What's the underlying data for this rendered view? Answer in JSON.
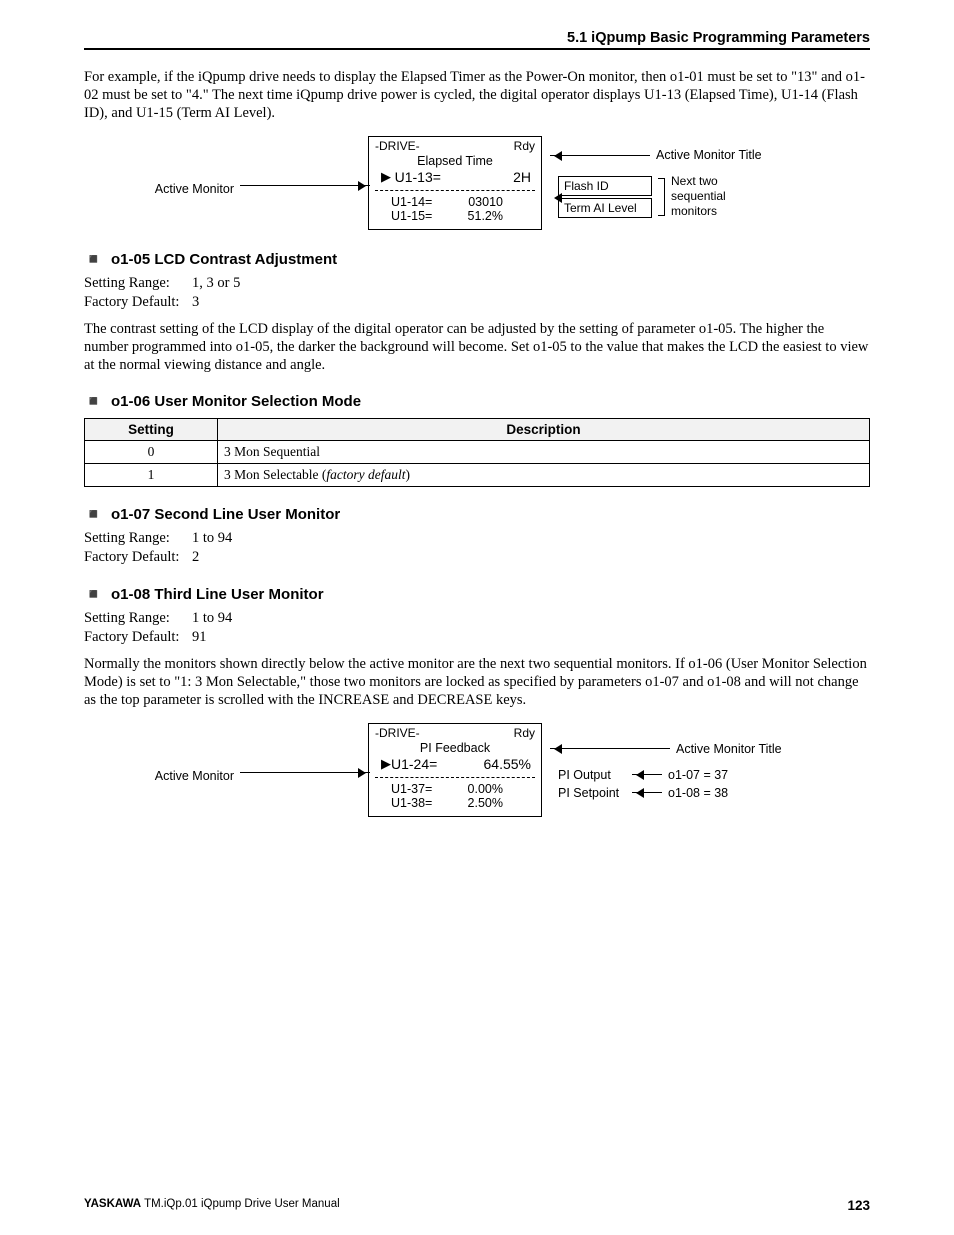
{
  "header": {
    "title": "5.1  iQpump Basic Programming Parameters"
  },
  "intro_para": "For example, if the iQpump drive needs to display the Elapsed Timer as the Power-On monitor, then o1-01 must be set to \"13\" and o1-02 must be set to \"4.\" The next time iQpump drive power is cycled, the digital operator displays U1-13 (Elapsed Time), U1-14 (Flash ID), and U1-15 (Term AI Level).",
  "diagram1": {
    "left_label": "Active Monitor",
    "lcd": {
      "top_left": "-DRIVE-",
      "top_right": "Rdy",
      "title": "Elapsed Time",
      "main_lbl": "U1-13=",
      "main_val": "2H",
      "sub1_lbl": "U1-14=",
      "sub1_val": "03010",
      "sub2_lbl": "U1-15=",
      "sub2_val": "51.2%"
    },
    "right": {
      "title_label": "Active Monitor Title",
      "box_line1": "Flash ID",
      "box_line2": "Term AI Level",
      "stack_label": "Next two\nsequential\nmonitors"
    }
  },
  "s1": {
    "heading": "o1-05 LCD Contrast Adjustment",
    "range_k": "Setting Range:",
    "range_v": "1, 3 or 5",
    "def_k": "Factory Default:",
    "def_v": "3",
    "body": "The contrast setting of the LCD display of the digital operator can be adjusted by the setting of parameter o1-05. The higher the number programmed into o1-05, the darker the background will become. Set o1-05 to the value that makes the LCD the easiest to view at the normal viewing distance and angle."
  },
  "s2": {
    "heading": "o1-06 User Monitor Selection Mode",
    "table": {
      "h1": "Setting",
      "h2": "Description",
      "rows": [
        {
          "setting": "0",
          "desc": "3 Mon Sequential"
        },
        {
          "setting": "1",
          "desc_pre": "3 Mon Selectable (",
          "desc_it": "factory default",
          "desc_post": ")"
        }
      ]
    }
  },
  "s3": {
    "heading": "o1-07 Second Line User Monitor",
    "range_k": "Setting Range:",
    "range_v": "1 to 94",
    "def_k": "Factory Default:",
    "def_v": "2"
  },
  "s4": {
    "heading": "o1-08 Third Line User Monitor",
    "range_k": "Setting Range:",
    "range_v": "1 to 94",
    "def_k": "Factory Default:",
    "def_v": "91",
    "body": "Normally the monitors shown directly below the active monitor are the next two sequential monitors. If o1-06 (User Monitor Selection Mode) is set to \"1: 3 Mon Selectable,\" those two monitors are locked as specified by parameters o1-07 and o1-08 and will not change as the top parameter is scrolled with the INCREASE and DECREASE keys."
  },
  "diagram2": {
    "left_label": "Active Monitor",
    "lcd": {
      "top_left": "-DRIVE-",
      "top_right": "Rdy",
      "title": "PI Feedback",
      "main_lbl": "U1-24=",
      "main_val": "64.55%",
      "sub1_lbl": "U1-37=",
      "sub1_val": "0.00%",
      "sub2_lbl": "U1-38=",
      "sub2_val": "2.50%"
    },
    "right": {
      "title_label": "Active Monitor Title",
      "box_line1": "PI Output",
      "box_line2": "PI Setpoint",
      "val1": "o1-07 = 37",
      "val2": "o1-08 = 38"
    }
  },
  "footer": {
    "left_bold": "YASKAWA",
    "left_rest": " TM.iQp.01 iQpump Drive User Manual",
    "page": "123"
  }
}
